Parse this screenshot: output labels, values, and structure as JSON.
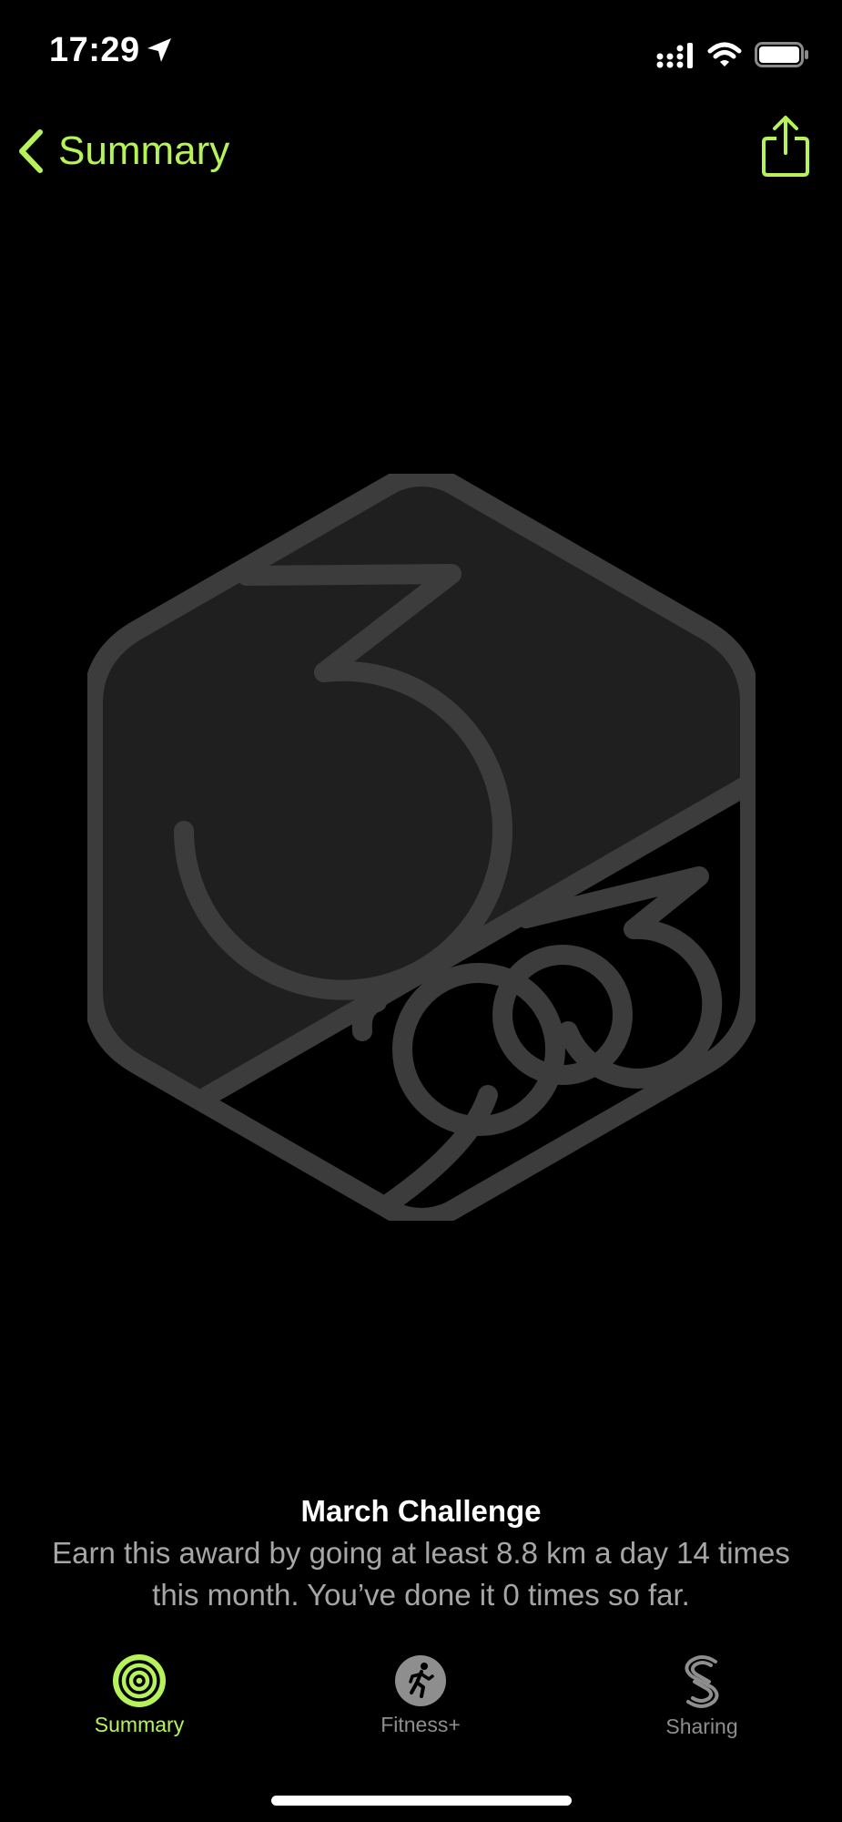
{
  "status_bar": {
    "time": "17:29",
    "icons": [
      "location-arrow-icon",
      "cellular-signal-icon",
      "wifi-icon",
      "battery-icon"
    ]
  },
  "nav": {
    "back_label": "Summary",
    "back_icon": "chevron-left-icon",
    "share_icon": "share-icon"
  },
  "award": {
    "title": "March Challenge",
    "description": "Earn this award by going at least 8.8 km a day 14 times this month. You’ve done it 0 times so far."
  },
  "tabs": [
    {
      "label": "Summary",
      "icon": "activity-rings-icon",
      "active": true
    },
    {
      "label": "Fitness+",
      "icon": "fitness-plus-icon",
      "active": false
    },
    {
      "label": "Sharing",
      "icon": "sharing-icon",
      "active": false
    }
  ],
  "colors": {
    "accent": "#b6f35a",
    "inactive": "#8e8e8e",
    "badge_fill": "#1f1f1f",
    "badge_stroke": "#3c3c3c"
  }
}
